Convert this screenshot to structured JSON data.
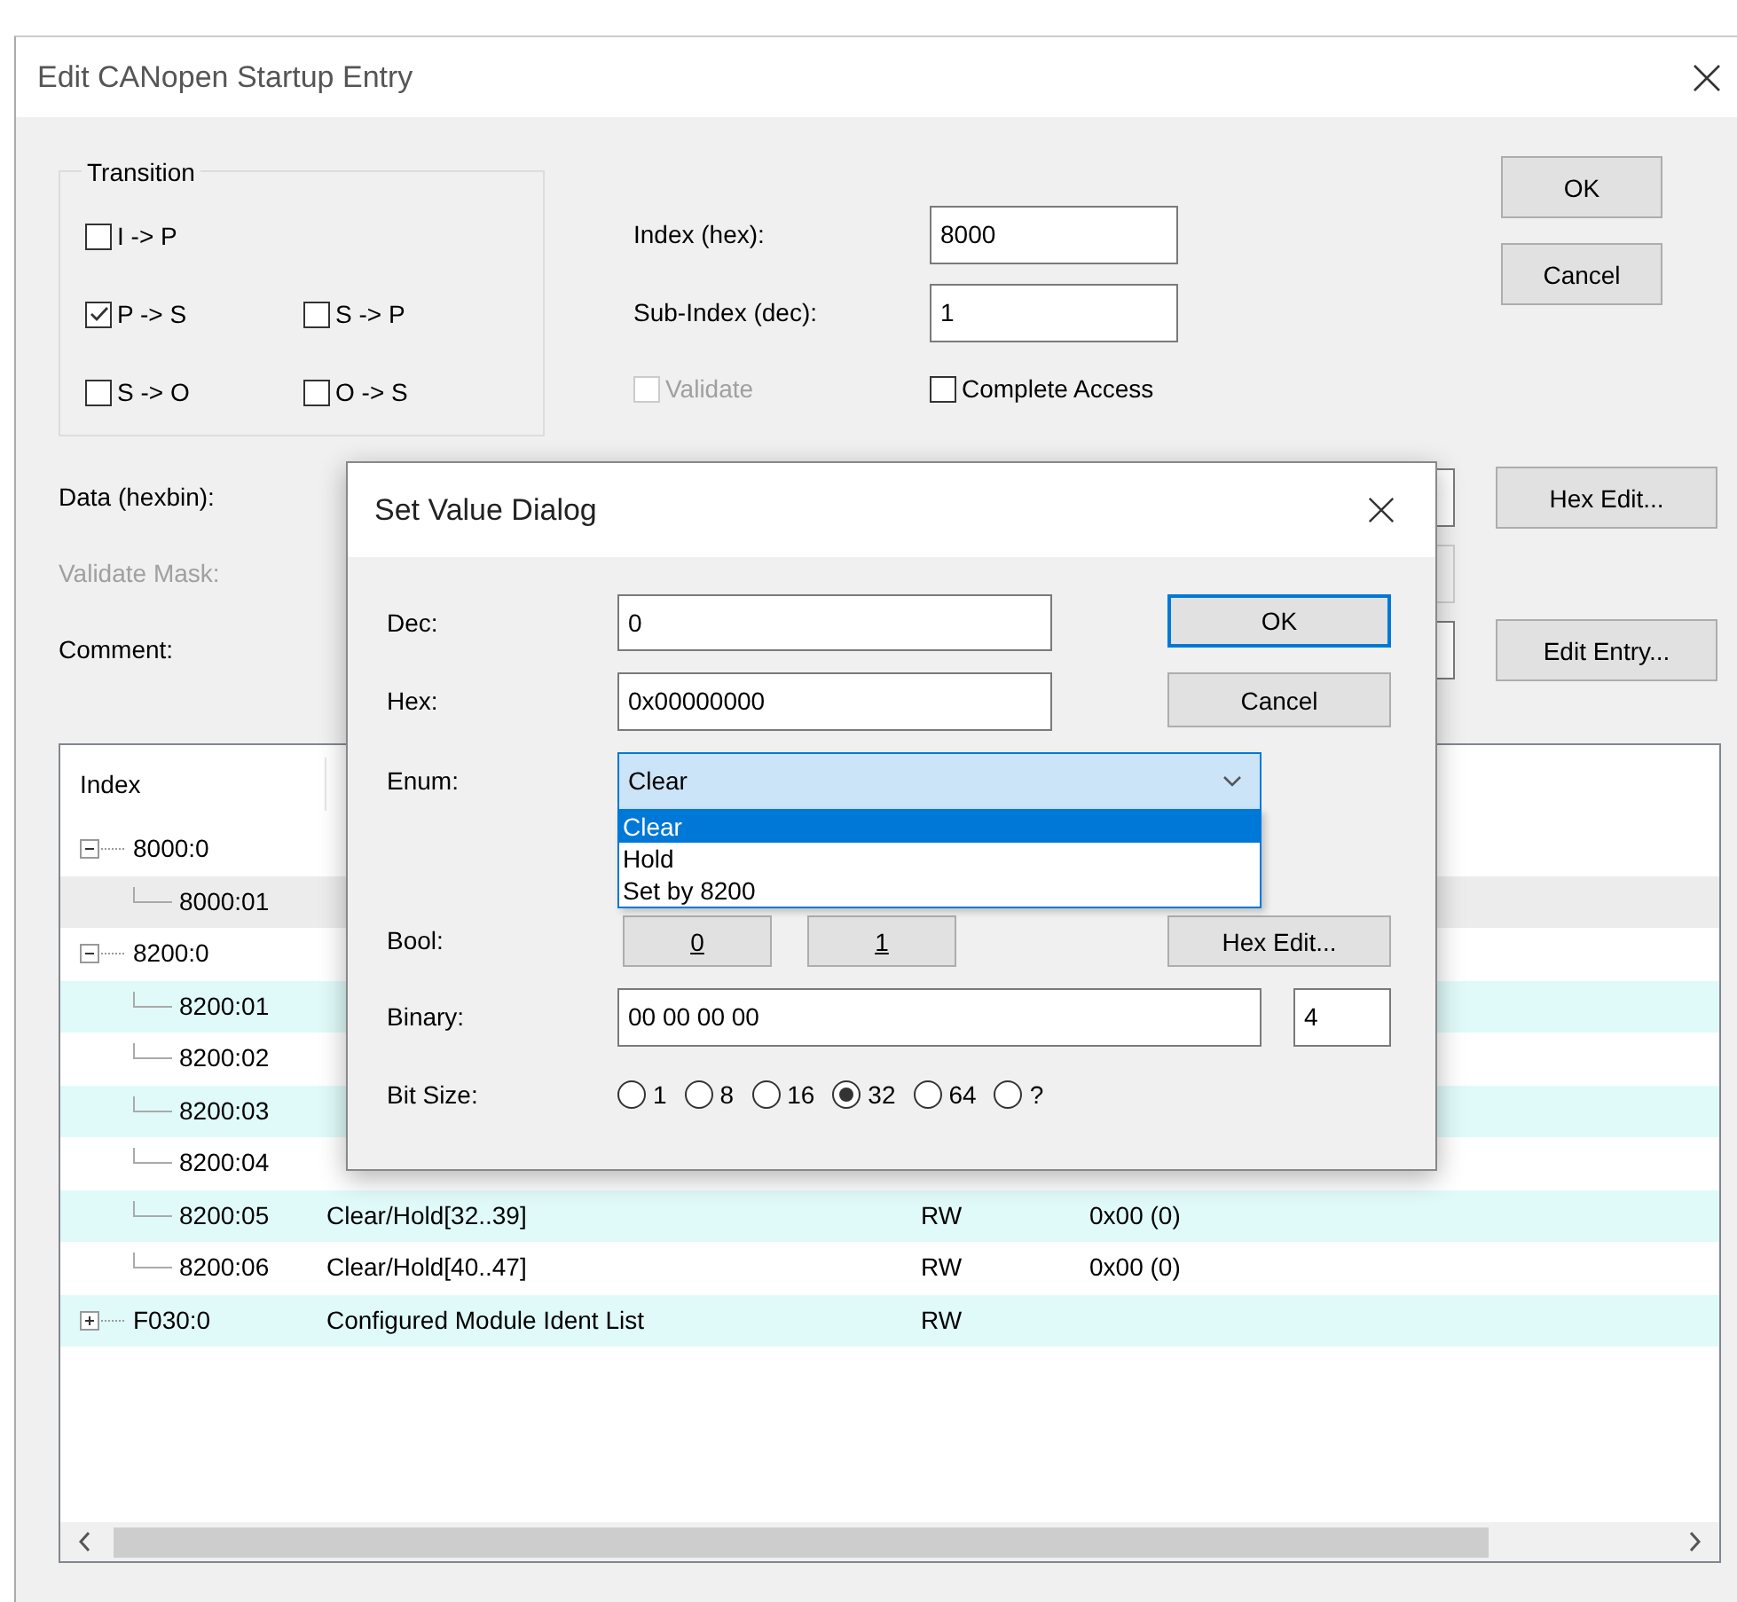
{
  "window": {
    "title": "Edit CANopen Startup Entry"
  },
  "transition": {
    "title": "Transition",
    "rows": [
      [
        {
          "label": "I -> P",
          "checked": false
        }
      ],
      [
        {
          "label": "P -> S",
          "checked": true
        },
        {
          "label": "S -> P",
          "checked": false
        }
      ],
      [
        {
          "label": "S -> O",
          "checked": false
        },
        {
          "label": "O -> S",
          "checked": false
        }
      ]
    ]
  },
  "fields": [
    {
      "label": "Index (hex):",
      "value": "8000"
    },
    {
      "label": "Sub-Index (dec):",
      "value": "1"
    }
  ],
  "validate": {
    "label": "Validate",
    "checked": false,
    "disabled": true
  },
  "complete_access": {
    "label": "Complete Access",
    "checked": false,
    "disabled": false
  },
  "buttons": [
    {
      "label": "OK",
      "default": false
    },
    {
      "label": "Cancel",
      "default": false
    }
  ],
  "data_rows": [
    {
      "label": "Data (hexbin):",
      "disabled": false,
      "button": "Hex Edit..."
    },
    {
      "label": "Validate Mask:",
      "disabled": true
    },
    {
      "label": "Comment:",
      "disabled": false,
      "button": "Edit Entry..."
    }
  ],
  "table": {
    "columns": [
      "Index"
    ],
    "rows": [
      {
        "index": "8000:0",
        "expanded": true,
        "selected": false,
        "children": [
          {
            "index": "8000:01",
            "selected": true
          }
        ]
      },
      {
        "index": "8200:0",
        "expanded": true,
        "selected": false,
        "children": [
          {
            "index": "8200:01",
            "selected": false
          },
          {
            "index": "8200:02",
            "selected": false
          },
          {
            "index": "8200:03",
            "selected": false
          },
          {
            "index": "8200:04",
            "selected": false
          },
          {
            "index": "8200:05",
            "name": "Clear/Hold[32..39]",
            "flags": "RW",
            "value": "0x00 (0)",
            "selected": false
          },
          {
            "index": "8200:06",
            "name": "Clear/Hold[40..47]",
            "flags": "RW",
            "value": "0x00 (0)",
            "selected": false
          }
        ]
      },
      {
        "index": "F030:0",
        "name": "Configured Module Ident List",
        "flags": "RW",
        "expanded": false,
        "selected": false
      }
    ]
  },
  "dialog": {
    "title": "Set Value Dialog",
    "dec": {
      "label": "Dec:",
      "value": "0"
    },
    "hex": {
      "label": "Hex:",
      "value": "0x00000000"
    },
    "buttons": [
      {
        "label": "OK",
        "default": true
      },
      {
        "label": "Cancel",
        "default": false
      }
    ],
    "enum": {
      "label": "Enum:",
      "value": "Clear",
      "expanded": true,
      "options": [
        {
          "label": "Clear",
          "selected": true
        },
        {
          "label": "Hold",
          "selected": false
        },
        {
          "label": "Set by 8200",
          "selected": false
        }
      ]
    },
    "bool": {
      "label": "Bool:",
      "buttons": [
        "0",
        "1"
      ]
    },
    "hex_edit": "Hex Edit...",
    "binary": {
      "label": "Binary:",
      "value": "00 00 00 00",
      "size": "4"
    },
    "bit_size": {
      "label": "Bit Size:",
      "options": [
        {
          "label": "1",
          "selected": false
        },
        {
          "label": "8",
          "selected": false
        },
        {
          "label": "16",
          "selected": false
        },
        {
          "label": "32",
          "selected": true
        },
        {
          "label": "64",
          "selected": false
        },
        {
          "label": "?",
          "selected": false
        }
      ]
    }
  }
}
